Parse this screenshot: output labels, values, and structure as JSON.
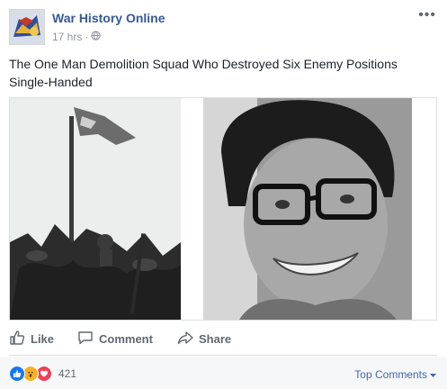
{
  "header": {
    "page_name": "War History Online",
    "time": "17 hrs",
    "separator": "·",
    "avatar_icon": "war-history-logo",
    "more_icon": "more-options-icon"
  },
  "post": {
    "text": "The One Man Demolition Squad Who Destroyed Six Enemy Positions Single-Handed"
  },
  "media": {
    "left_image": "soldier-flag-photo",
    "right_image": "smiling-man-glasses-photo"
  },
  "actions": {
    "like": "Like",
    "comment": "Comment",
    "share": "Share"
  },
  "footer": {
    "reaction_count": "421",
    "top_comments": "Top Comments"
  },
  "colors": {
    "link": "#365899",
    "muted": "#90949c",
    "action": "#606770",
    "like_blue": "#1877f2",
    "wow_yellow": "#f7b125",
    "love_red": "#f33e58"
  }
}
